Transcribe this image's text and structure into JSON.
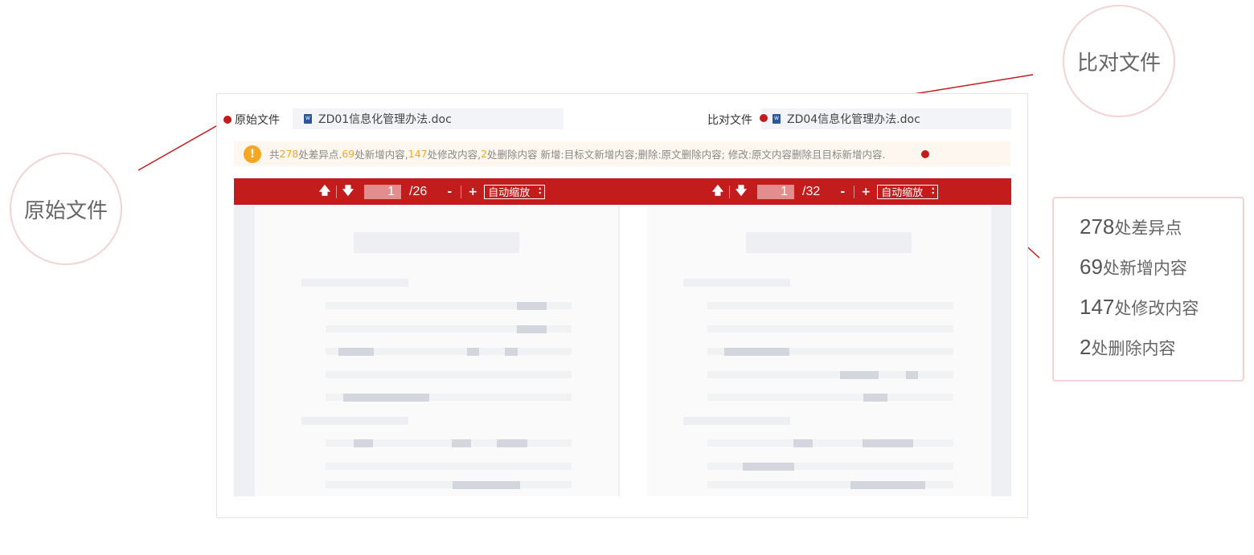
{
  "original": {
    "label": "原始文件",
    "filename": "ZD01信息化管理办法.doc"
  },
  "compare": {
    "label": "比对文件",
    "filename": "ZD04信息化管理办法.doc"
  },
  "notice": {
    "prefix": "共",
    "diff_count": "278",
    "diff_text": "处差异点.",
    "add_count": "69",
    "add_text": "处新增内容,",
    "mod_count": "147",
    "mod_text": "处修改内容,",
    "del_count": "2",
    "del_text": "处删除内容 新增:目标文新增内容;删除:原文删除内容; 修改:原文内容删除且目标新增内容."
  },
  "left_viewer": {
    "page": "1",
    "total": "/26",
    "zoom": "自动缩放"
  },
  "right_viewer": {
    "page": "1",
    "total": "/32",
    "zoom": "自动缩放"
  },
  "callouts": {
    "original": "原始文件",
    "compare": "比对文件"
  },
  "summary": [
    {
      "num": "278",
      "text": "处差异点"
    },
    {
      "num": "69",
      "text": "处新增内容"
    },
    {
      "num": "147",
      "text": "处修改内容"
    },
    {
      "num": "2",
      "text": "处删除内容"
    }
  ],
  "colors": {
    "accent": "#c21c1c",
    "highlight": "#f5a623",
    "callout_border": "#f3d3d3"
  },
  "icons": [
    "word-doc-icon",
    "warning-icon",
    "arrow-up-icon",
    "arrow-down-icon"
  ]
}
